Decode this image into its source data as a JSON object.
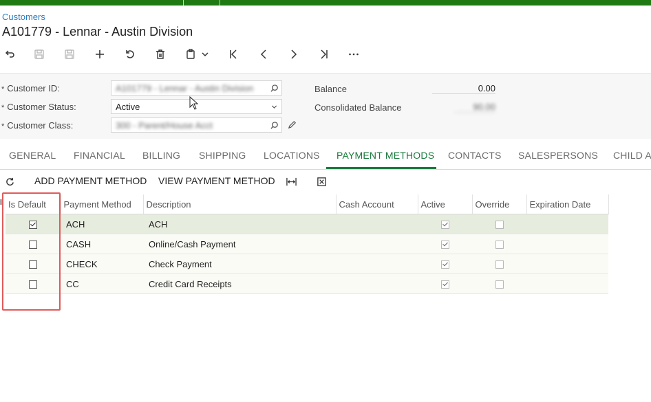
{
  "breadcrumb": "Customers",
  "title": "A101779 - Lennar - Austin Division",
  "toolbar": {
    "icons": [
      "undo-back-icon",
      "save-icon",
      "save-close-icon",
      "add-icon",
      "cancel-icon",
      "delete-icon",
      "copy-paste-icon",
      "chevron-down-icon",
      "first-record-icon",
      "prev-record-icon",
      "next-record-icon",
      "last-record-icon",
      "more-icon"
    ]
  },
  "form": {
    "customer_id_label": "Customer ID:",
    "customer_id_value": "A101779 - Lennar - Austin Division",
    "customer_status_label": "Customer Status:",
    "customer_status_value": "Active",
    "customer_class_label": "Customer Class:",
    "customer_class_value": "300 - Parent/House Acct",
    "balance_label": "Balance",
    "balance_value": "0.00",
    "consolidated_balance_label": "Consolidated Balance",
    "consolidated_balance_value": "90.00",
    "required_mark": "*"
  },
  "tabs": [
    "GENERAL",
    "FINANCIAL",
    "BILLING",
    "SHIPPING",
    "LOCATIONS",
    "PAYMENT METHODS",
    "CONTACTS",
    "SALESPERSONS",
    "CHILD AC"
  ],
  "active_tab": "PAYMENT METHODS",
  "grid_toolbar": {
    "add_label": "ADD PAYMENT METHOD",
    "view_label": "VIEW PAYMENT METHOD"
  },
  "grid": {
    "columns": [
      "Is Default",
      "Payment Method",
      "Description",
      "Cash Account",
      "Active",
      "Override",
      "Expiration Date"
    ],
    "rows": [
      {
        "is_default": true,
        "method": "ACH",
        "description": "ACH",
        "cash_account": "",
        "active": true,
        "override": false,
        "expiration": ""
      },
      {
        "is_default": false,
        "method": "CASH",
        "description": "Online/Cash Payment",
        "cash_account": "",
        "active": true,
        "override": false,
        "expiration": ""
      },
      {
        "is_default": false,
        "method": "CHECK",
        "description": "Check Payment",
        "cash_account": "",
        "active": true,
        "override": false,
        "expiration": ""
      },
      {
        "is_default": false,
        "method": "CC",
        "description": "Credit Card Receipts",
        "cash_account": "",
        "active": true,
        "override": false,
        "expiration": ""
      }
    ]
  },
  "colors": {
    "accent_green": "#1a7a3d",
    "top_bar": "#207a14",
    "link_blue": "#2f7bbf",
    "highlight_red": "#e05a5a"
  }
}
